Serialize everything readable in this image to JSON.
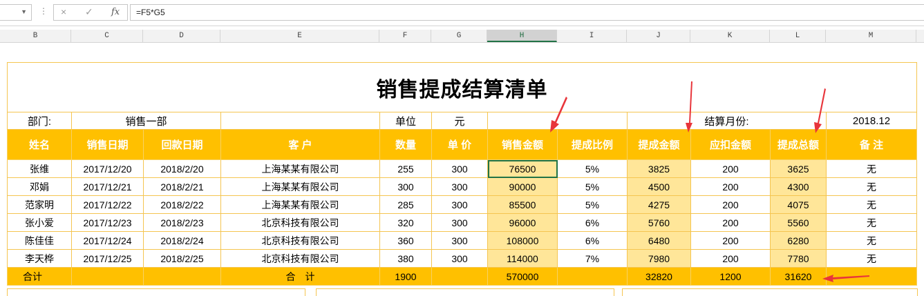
{
  "formula_bar": {
    "name_box": "",
    "cancel_icon": "×",
    "enter_icon": "✓",
    "fx_label": "fx",
    "formula": "=F5*G5"
  },
  "columns": [
    "B",
    "C",
    "D",
    "E",
    "F",
    "G",
    "H",
    "I",
    "J",
    "K",
    "L",
    "M"
  ],
  "selected_column": "H",
  "sheet": {
    "title": "销售提成结算清单",
    "info": {
      "dept_label": "部门:",
      "dept_value": "销售一部",
      "unit_label": "单位",
      "unit_value": "元",
      "month_label": "结算月份:",
      "month_value": "2018.12"
    },
    "headers": [
      "姓名",
      "销售日期",
      "回款日期",
      "客 户",
      "数量",
      "单 价",
      "销售金额",
      "提成比例",
      "提成金额",
      "应扣金额",
      "提成总额",
      "备 注"
    ],
    "rows": [
      [
        "张维",
        "2017/12/20",
        "2018/2/20",
        "上海某某有限公司",
        "255",
        "300",
        "76500",
        "5%",
        "3825",
        "200",
        "3625",
        "无"
      ],
      [
        "邓娟",
        "2017/12/21",
        "2018/2/21",
        "上海某某有限公司",
        "300",
        "300",
        "90000",
        "5%",
        "4500",
        "200",
        "4300",
        "无"
      ],
      [
        "范家明",
        "2017/12/22",
        "2018/2/22",
        "上海某某有限公司",
        "285",
        "300",
        "85500",
        "5%",
        "4275",
        "200",
        "4075",
        "无"
      ],
      [
        "张小爱",
        "2017/12/23",
        "2018/2/23",
        "北京科技有限公司",
        "320",
        "300",
        "96000",
        "6%",
        "5760",
        "200",
        "5560",
        "无"
      ],
      [
        "陈佳佳",
        "2017/12/24",
        "2018/2/24",
        "北京科技有限公司",
        "360",
        "300",
        "108000",
        "6%",
        "6480",
        "200",
        "6280",
        "无"
      ],
      [
        "李天桦",
        "2017/12/25",
        "2018/2/25",
        "北京科技有限公司",
        "380",
        "300",
        "114000",
        "7%",
        "7980",
        "200",
        "7780",
        "无"
      ]
    ],
    "totals": {
      "label": "合计",
      "customer_label": "合　计",
      "quantity": "1900",
      "sales": "570000",
      "commission": "32820",
      "deduction": "1200",
      "net": "31620"
    }
  },
  "colors": {
    "header_bg": "#ffc000",
    "highlight": "#ffe699",
    "border": "#f5c550",
    "arrow": "#e8353b",
    "selection": "#217346"
  }
}
